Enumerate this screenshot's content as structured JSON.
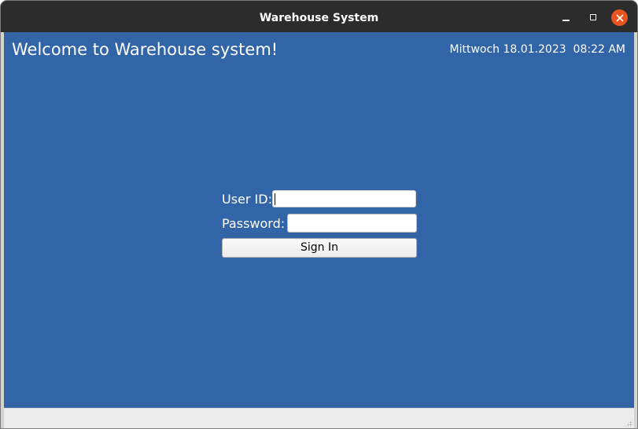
{
  "window": {
    "title": "Warehouse System"
  },
  "header": {
    "welcome": "Welcome to Warehouse system!",
    "datetime": "Mittwoch 18.01.2023  08:22 AM"
  },
  "login": {
    "user_label": "User ID:",
    "user_value": "",
    "password_label": "Password:",
    "password_value": "",
    "signin_label": "Sign In"
  },
  "colors": {
    "background": "#3265a8",
    "titlebar": "#2c2c2c",
    "close_button": "#e95420"
  },
  "icons": {
    "minimize": "minimize-icon",
    "maximize": "maximize-icon",
    "close": "close-icon"
  }
}
